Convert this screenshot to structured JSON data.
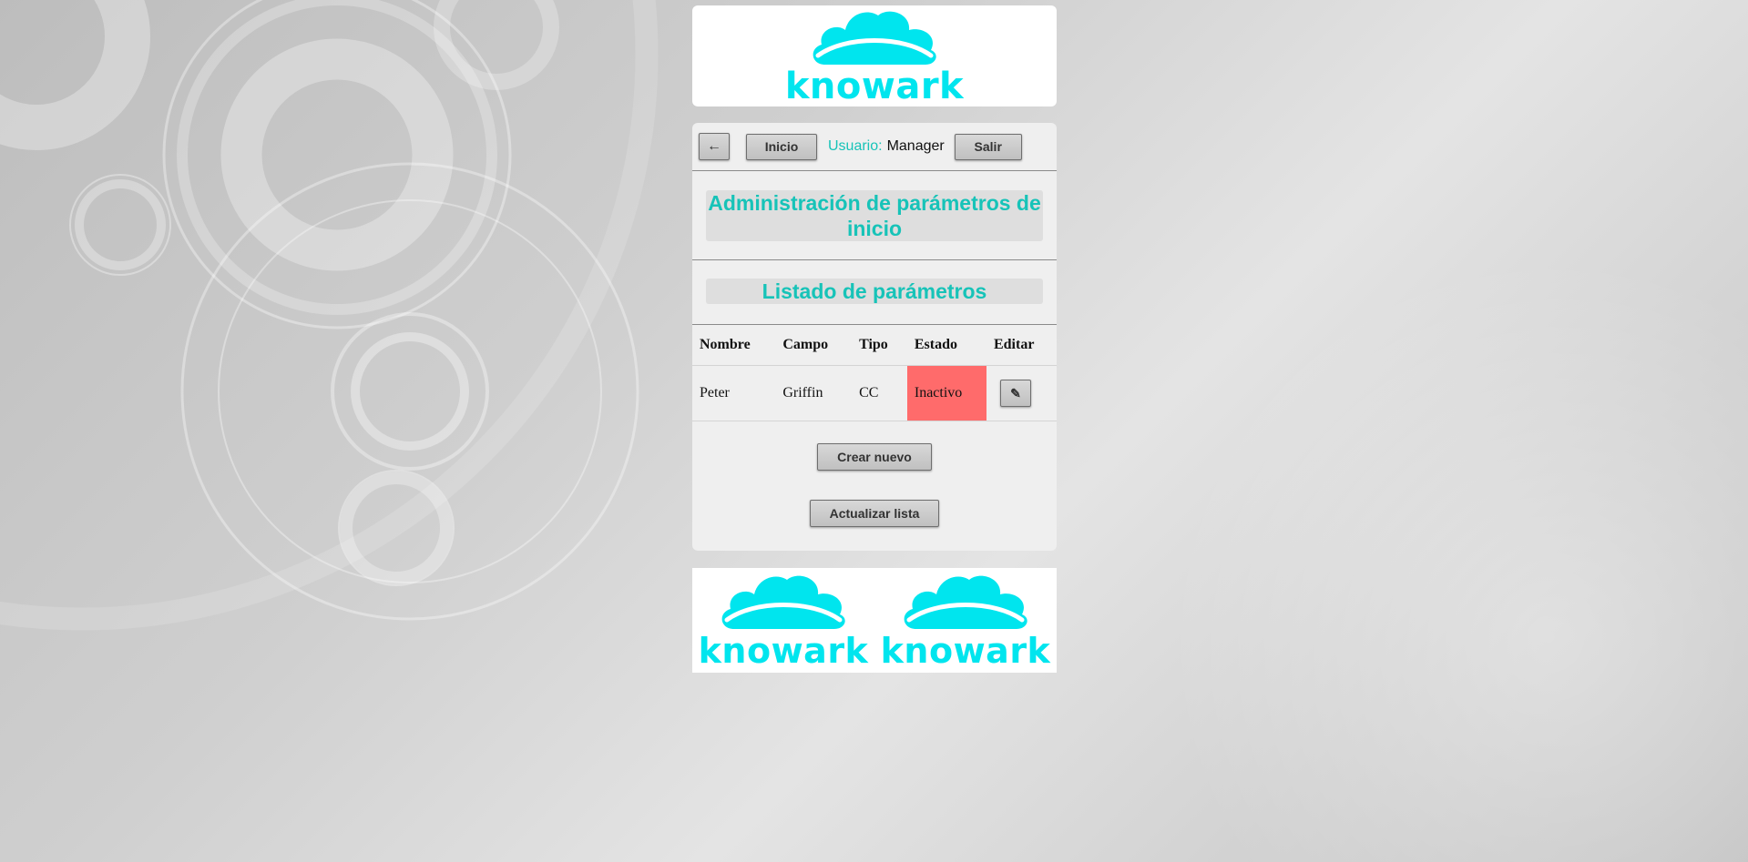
{
  "colors": {
    "accent": "#17c3b8",
    "logo": "#00e5ee",
    "inactive": "#ff6b6b"
  },
  "header": {
    "logo_text": "knowark"
  },
  "nav": {
    "back_icon": "←",
    "home_label": "Inicio",
    "user_label": "Usuario:",
    "user_name": "Manager",
    "logout_label": "Salir"
  },
  "page": {
    "title": "Administración de parámetros de inicio",
    "list_title": "Listado de parámetros"
  },
  "table": {
    "headers": [
      "Nombre",
      "Campo",
      "Tipo",
      "Estado",
      "Editar"
    ],
    "rows": [
      {
        "nombre": "Peter",
        "campo": "Griffin",
        "tipo": "CC",
        "estado": "Inactivo",
        "edit_icon": "✎"
      }
    ]
  },
  "actions": {
    "create_label": "Crear nuevo",
    "refresh_label": "Actualizar lista"
  },
  "footer": {
    "logo_left_text": "knowark",
    "logo_right_text": "knowark"
  }
}
